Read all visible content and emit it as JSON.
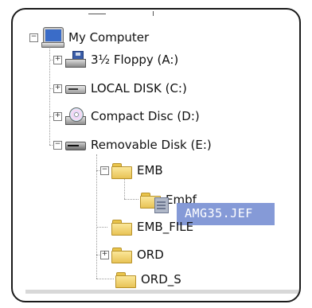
{
  "tree": {
    "root": {
      "label": "My Computer",
      "toggle": "−",
      "icon": "computer-icon"
    },
    "drives": [
      {
        "label": "3½ Floppy (A:)",
        "toggle": "+",
        "icon": "floppy-drive-icon"
      },
      {
        "label": "LOCAL DISK (C:)",
        "toggle": "+",
        "icon": "hard-drive-icon"
      },
      {
        "label": "Compact Disc (D:)",
        "toggle": "+",
        "icon": "cd-drive-icon"
      },
      {
        "label": "Removable Disk (E:)",
        "toggle": "−",
        "icon": "removable-drive-icon"
      }
    ],
    "folders": [
      {
        "label": "EMB",
        "toggle": "−",
        "icon": "folder-icon"
      },
      {
        "label": "Embf",
        "icon": "folder-icon"
      },
      {
        "label": "EMB_FILE",
        "icon": "folder-icon"
      },
      {
        "label": "ORD",
        "toggle": "+",
        "icon": "folder-icon"
      },
      {
        "label": "ORD_S",
        "icon": "folder-icon"
      }
    ]
  },
  "drag": {
    "filename": "AMG35.JEF",
    "icon": "file-icon"
  },
  "colors": {
    "selection": "#7b92d4",
    "folder": "#f2d46c",
    "tree_lines": "#9a9a9a"
  }
}
